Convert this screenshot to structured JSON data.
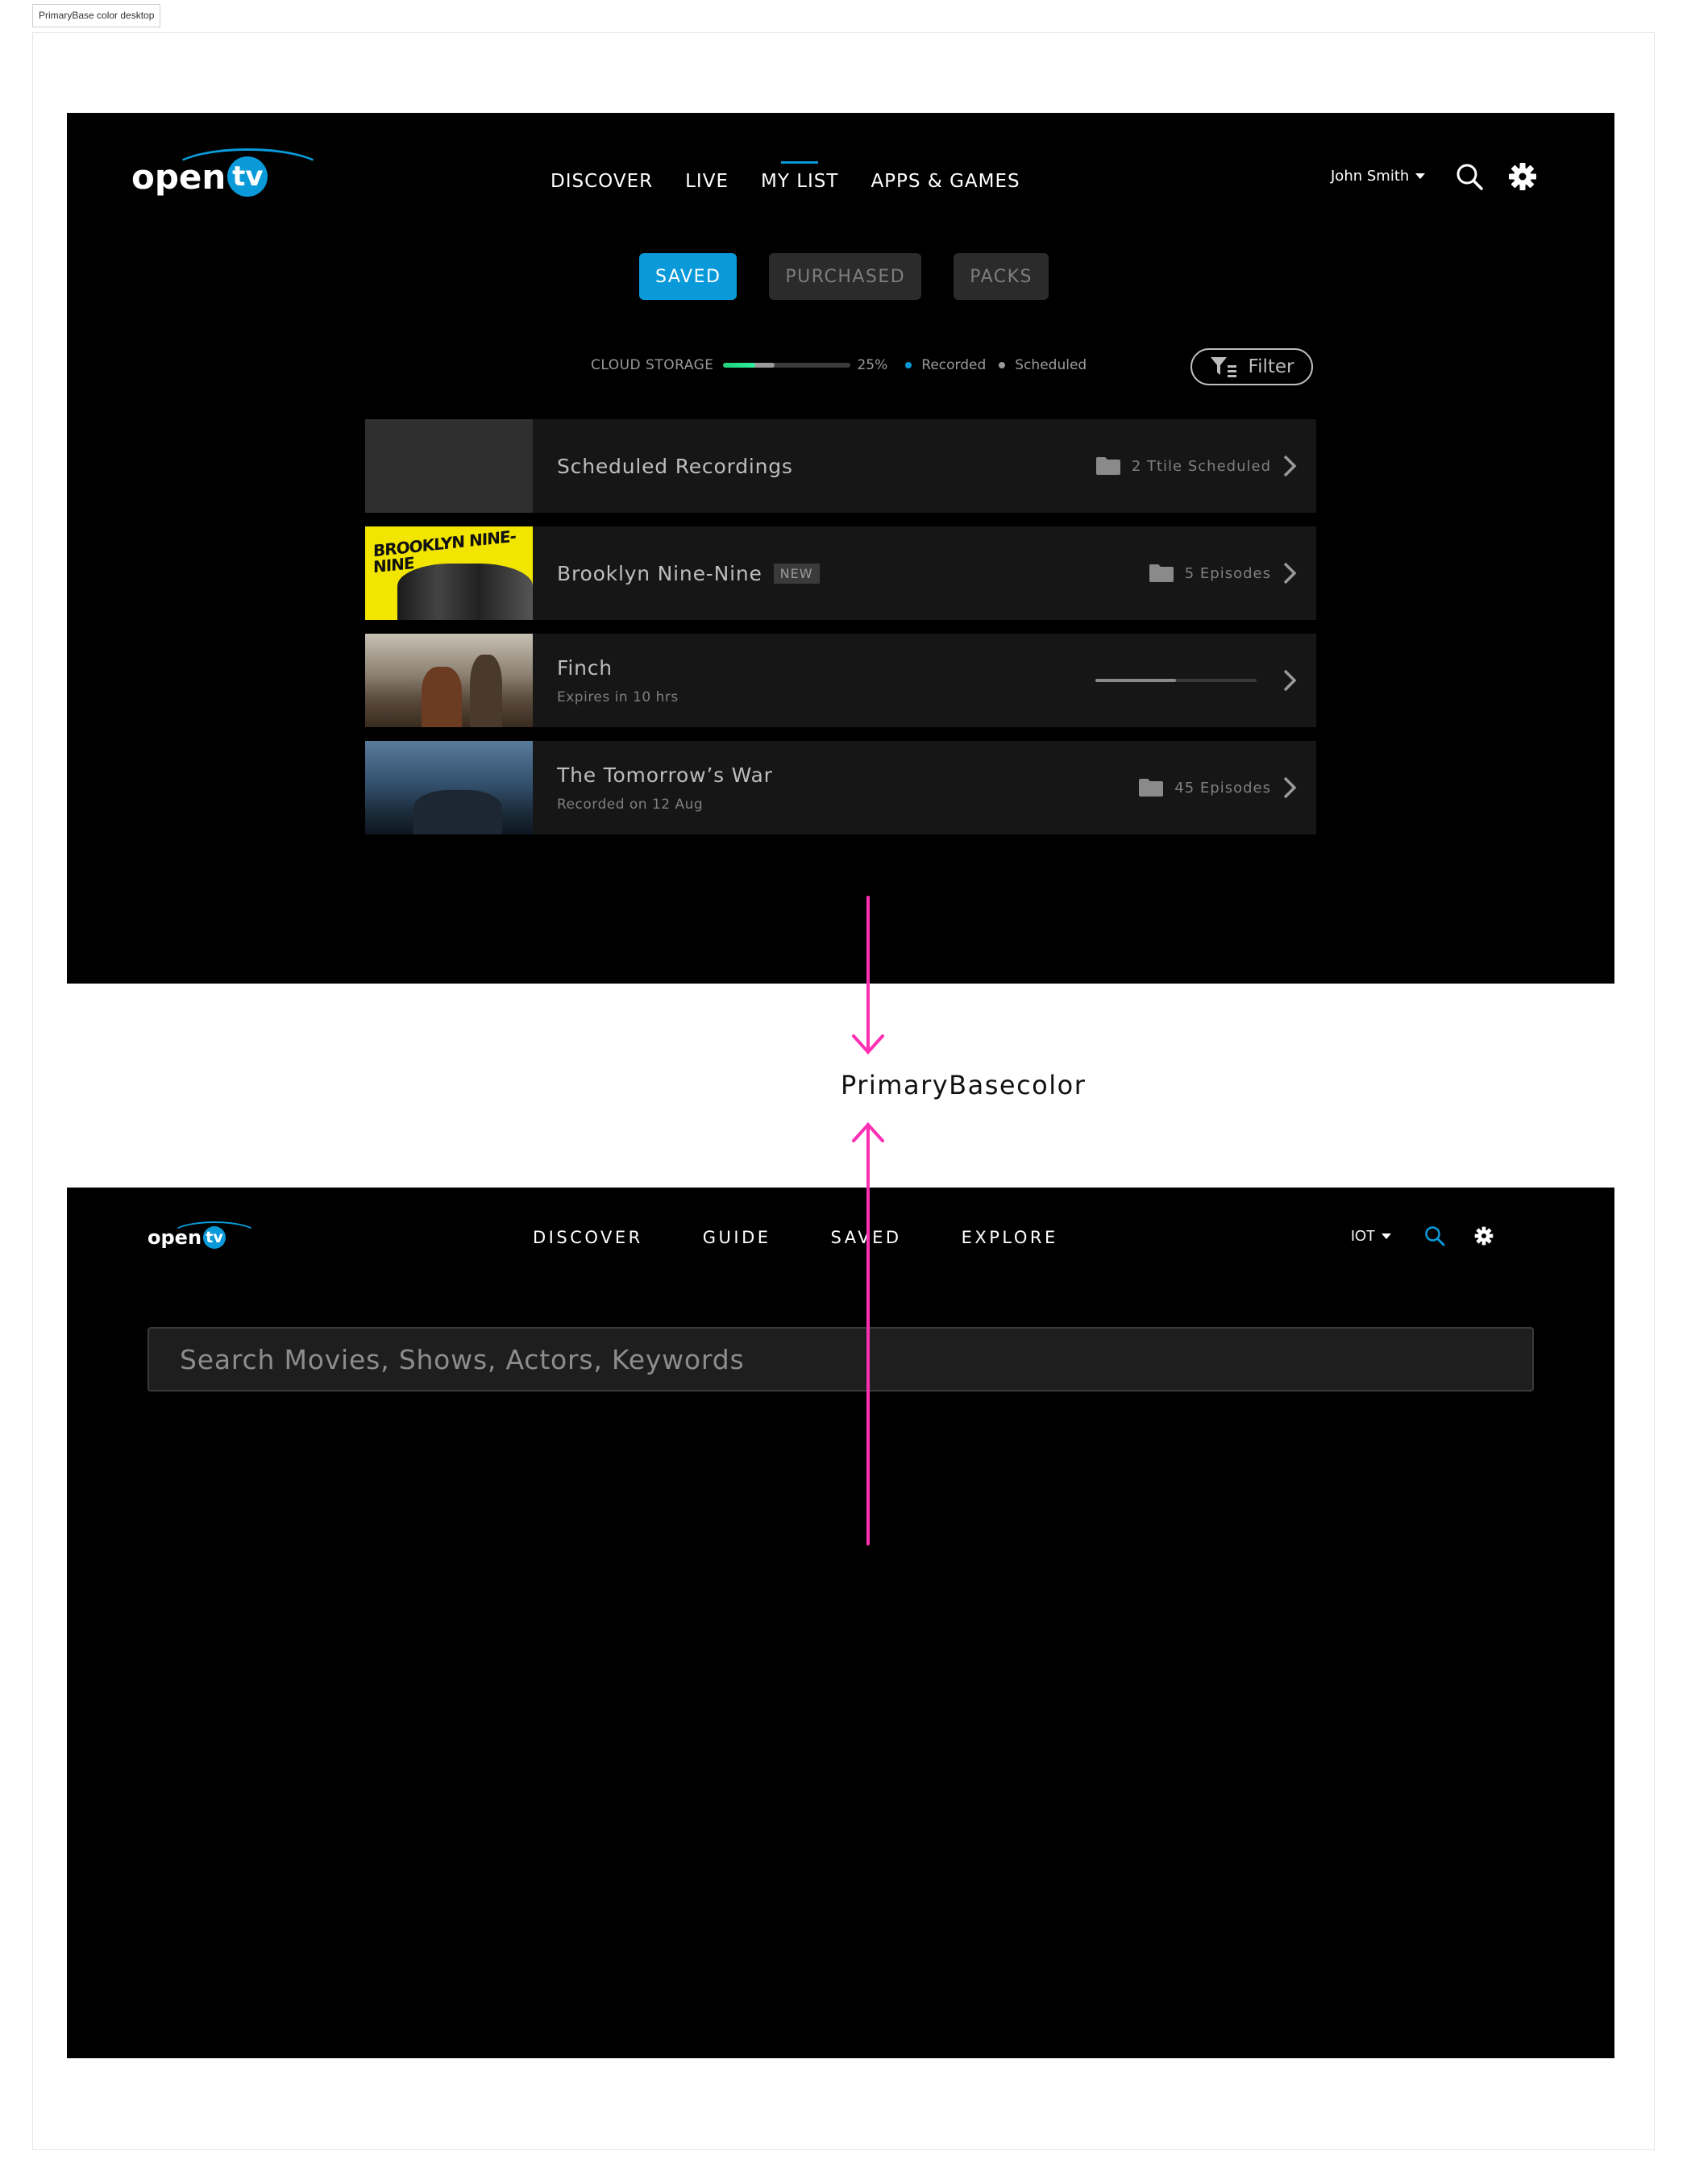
{
  "frame": {
    "label": "PrimaryBase color desktop"
  },
  "top_screen": {
    "logo": {
      "text": "open",
      "badge": "tv"
    },
    "nav": [
      {
        "label": "DISCOVER",
        "active": false
      },
      {
        "label": "LIVE",
        "active": false
      },
      {
        "label": "MY LIST",
        "active": true
      },
      {
        "label": "APPS & GAMES",
        "active": false
      }
    ],
    "user": {
      "name": "John Smith",
      "icon": "chevron-down-icon"
    },
    "icons": {
      "search": "search-icon",
      "settings": "gear-icon"
    },
    "tabs": [
      {
        "label": "SAVED",
        "active": true
      },
      {
        "label": "PURCHASED",
        "active": false
      },
      {
        "label": "PACKS",
        "active": false
      }
    ],
    "storage": {
      "label": "CLOUD STORAGE",
      "percent_text": "25%",
      "recorded_fraction": 0.25,
      "scheduled_fraction": 0.15,
      "legend": [
        {
          "label": "Recorded",
          "color": "#0a9ad9"
        },
        {
          "label": "Scheduled",
          "color": "#9a9a9a"
        }
      ]
    },
    "filter": {
      "label": "Filter",
      "icon": "filter-icon"
    },
    "rows": [
      {
        "title": "Scheduled Recordings",
        "subtitle": "",
        "badge": "",
        "meta": "2 Ttile Scheduled",
        "thumb": "empty",
        "progress": null
      },
      {
        "title": "Brooklyn Nine-Nine",
        "subtitle": "",
        "badge": "NEW",
        "meta": "5 Episodes",
        "thumb": "b99",
        "thumb_text": "BROOKLYN NINE-NINE",
        "progress": null
      },
      {
        "title": "Finch",
        "subtitle": "Expires in 10 hrs",
        "badge": "",
        "meta": "",
        "thumb": "finch",
        "progress": 0.5
      },
      {
        "title": "The Tomorrow’s War",
        "subtitle": "Recorded on 12 Aug",
        "badge": "",
        "meta": "45 Episodes",
        "thumb": "tomorrow",
        "progress": null
      }
    ]
  },
  "annotation": {
    "label": "PrimaryBasecolor",
    "color": "#ff2fb4"
  },
  "bottom_screen": {
    "logo": {
      "text": "open",
      "badge": "tv"
    },
    "nav": [
      {
        "label": "DISCOVER"
      },
      {
        "label": "GUIDE"
      },
      {
        "label": "SAVED"
      },
      {
        "label": "EXPLORE"
      }
    ],
    "device": {
      "name": "IOT"
    },
    "search": {
      "placeholder": "Search Movies, Shows, Actors, Keywords"
    }
  }
}
